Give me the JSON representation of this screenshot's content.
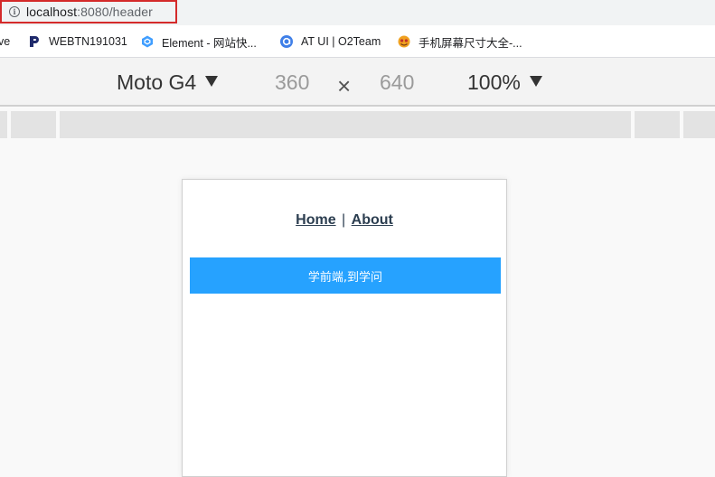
{
  "address_bar": {
    "host": "localhost",
    "port_path": ":8080/header"
  },
  "bookmarks": [
    {
      "label": "ve",
      "icon": "none"
    },
    {
      "label": "WEBTN191031",
      "icon": "p-logo-icon"
    },
    {
      "label": "Element - 网站快...",
      "icon": "element-logo-icon"
    },
    {
      "label": "AT UI | O2Team",
      "icon": "at-ui-logo-icon"
    },
    {
      "label": "手机屏幕尺寸大全-...",
      "icon": "favicon-icon"
    }
  ],
  "device_toolbar": {
    "device": "Moto G4",
    "width": "360",
    "times": "×",
    "height": "640",
    "zoom": "100%"
  },
  "page": {
    "nav": {
      "home": "Home",
      "separator": "|",
      "about": "About"
    },
    "banner_text": "学前端,到学问"
  },
  "colors": {
    "banner": "#26a2ff",
    "nav_text": "#2c3e50",
    "url_highlight": "#d42a2a"
  }
}
